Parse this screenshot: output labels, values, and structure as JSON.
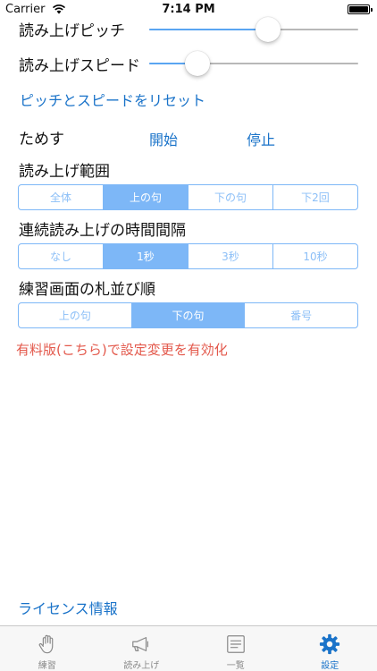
{
  "status_bar": {
    "carrier": "Carrier",
    "time": "7:14 PM",
    "battery_level": 1.0
  },
  "pitch": {
    "label": "読み上げピッチ",
    "value": 0.57
  },
  "speed": {
    "label": "読み上げスピード",
    "value": 0.23
  },
  "reset_label": "ピッチとスピードをリセット",
  "test": {
    "label": "ためす",
    "start": "開始",
    "stop": "停止"
  },
  "range": {
    "label": "読み上げ範囲",
    "options": [
      "全体",
      "上の句",
      "下の句",
      "下2回"
    ],
    "selected": 1
  },
  "interval": {
    "label": "連続読み上げの時間間隔",
    "options": [
      "なし",
      "1秒",
      "3秒",
      "10秒"
    ],
    "selected": 1
  },
  "order": {
    "label": "練習画面の札並び順",
    "options": [
      "上の句",
      "下の句",
      "番号"
    ],
    "selected": 1
  },
  "upgrade_notice": "有料版(こちら)で設定変更を有効化",
  "license_label": "ライセンス情報",
  "tabs": [
    {
      "label": "練習",
      "icon": "hand-icon",
      "active": false
    },
    {
      "label": "読み上げ",
      "icon": "megaphone-icon",
      "active": false
    },
    {
      "label": "一覧",
      "icon": "list-icon",
      "active": false
    },
    {
      "label": "設定",
      "icon": "gear-icon",
      "active": true
    }
  ],
  "colors": {
    "accent": "#1a73c9",
    "segment": "#7db7f7",
    "warning": "#e3584b"
  }
}
